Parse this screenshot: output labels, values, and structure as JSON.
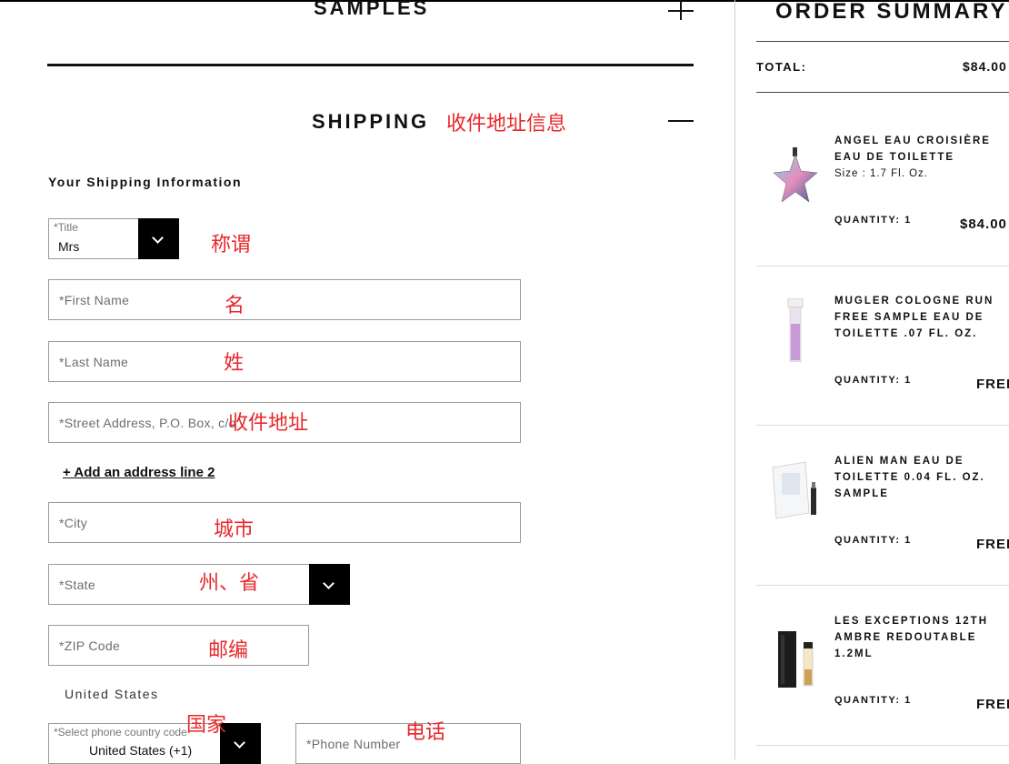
{
  "checkout": {
    "samples_title": "SAMPLES",
    "shipping_title": "SHIPPING",
    "shipping_subheading": "Your Shipping Information",
    "title_field": {
      "label": "*Title",
      "value": "Mrs"
    },
    "first_name": {
      "placeholder": "*First Name"
    },
    "last_name": {
      "placeholder": "*Last Name"
    },
    "street": {
      "placeholder": "*Street Address, P.O. Box, c/o"
    },
    "add_address_line": "+ Add an address line 2",
    "city": {
      "placeholder": "*City"
    },
    "state": {
      "placeholder": "*State"
    },
    "zip": {
      "placeholder": "*ZIP Code"
    },
    "country": "United States",
    "phone_country": {
      "label": "*Select phone country code",
      "value": "United States (+1)"
    },
    "phone_number": {
      "placeholder": "*Phone Number"
    }
  },
  "annotations": {
    "shipping": "收件地址信息",
    "title": "称谓",
    "first_name": "名",
    "last_name": "姓",
    "street": "收件地址",
    "city": "城市",
    "state": "州、省",
    "zip": "邮编",
    "country": "国家",
    "phone": "电话"
  },
  "order_summary": {
    "title": "ORDER SUMMARY",
    "total_label": "TOTAL:",
    "total_value": "$84.00",
    "items": [
      {
        "name": "ANGEL EAU CROISIÈRE EAU DE TOILETTE",
        "size": "Size : 1.7 Fl. Oz.",
        "quantity": "QUANTITY: 1",
        "price": "$84.00",
        "image_icon": "star-perfume-bottle-icon"
      },
      {
        "name": "MUGLER COLOGNE RUN FREE SAMPLE EAU DE TOILETTE .07 FL. OZ.",
        "size": "",
        "quantity": "QUANTITY: 1",
        "price": "FREE",
        "image_icon": "vial-icon"
      },
      {
        "name": "ALIEN MAN EAU DE TOILETTE 0.04 FL. OZ. SAMPLE",
        "size": "",
        "quantity": "QUANTITY: 1",
        "price": "FREE",
        "image_icon": "sample-card-icon"
      },
      {
        "name": "LES EXCEPTIONS 12TH AMBRE REDOUTABLE 1.2ML",
        "size": "",
        "quantity": "QUANTITY: 1",
        "price": "FREE",
        "image_icon": "box-vial-icon"
      }
    ]
  },
  "colors": {
    "annotation": "#e8282b",
    "accent": "#000000"
  }
}
